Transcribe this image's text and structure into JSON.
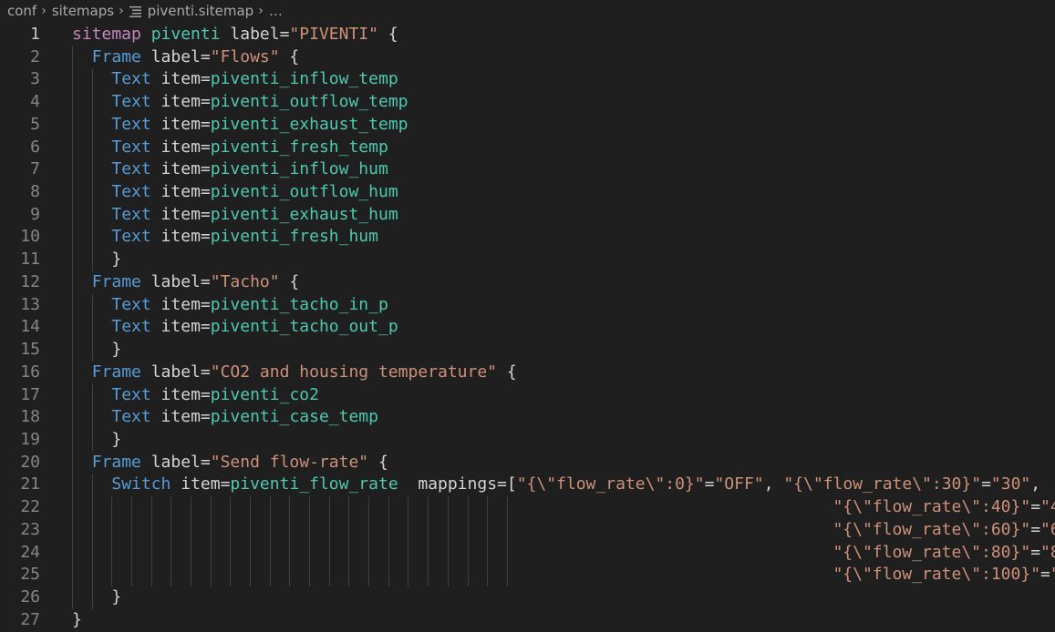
{
  "breadcrumb": {
    "items": [
      "conf",
      "sitemaps",
      "piventi.sitemap",
      "…"
    ],
    "separator": "›"
  },
  "icons": {
    "file_icon": "lines-file-icon",
    "chevron": "chevron-right-icon"
  },
  "colors": {
    "background": "#1f1f1f",
    "keyword_purple": "#c586c0",
    "keyword_blue": "#569cd6",
    "identifier_teal": "#4ec9b0",
    "string_orange": "#ce9178",
    "default_text": "#d4d4d4",
    "line_number": "#858585"
  },
  "editor": {
    "active_line": 1,
    "lines": [
      {
        "n": "1",
        "tokens": [
          {
            "t": "sitemap",
            "c": "kw"
          },
          {
            "t": " "
          },
          {
            "t": "piventi",
            "c": "id"
          },
          {
            "t": " label="
          },
          {
            "t": "\"PIVENTI\"",
            "c": "str"
          },
          {
            "t": " {"
          }
        ]
      },
      {
        "n": "2",
        "tokens": [
          {
            "t": "  "
          },
          {
            "t": "Frame",
            "c": "kw2"
          },
          {
            "t": " label="
          },
          {
            "t": "\"Flows\"",
            "c": "str"
          },
          {
            "t": " {"
          }
        ]
      },
      {
        "n": "3",
        "tokens": [
          {
            "t": "    "
          },
          {
            "t": "Text",
            "c": "kw2"
          },
          {
            "t": " item="
          },
          {
            "t": "piventi_inflow_temp",
            "c": "id"
          }
        ]
      },
      {
        "n": "4",
        "tokens": [
          {
            "t": "    "
          },
          {
            "t": "Text",
            "c": "kw2"
          },
          {
            "t": " item="
          },
          {
            "t": "piventi_outflow_temp",
            "c": "id"
          }
        ]
      },
      {
        "n": "5",
        "tokens": [
          {
            "t": "    "
          },
          {
            "t": "Text",
            "c": "kw2"
          },
          {
            "t": " item="
          },
          {
            "t": "piventi_exhaust_temp",
            "c": "id"
          }
        ]
      },
      {
        "n": "6",
        "tokens": [
          {
            "t": "    "
          },
          {
            "t": "Text",
            "c": "kw2"
          },
          {
            "t": " item="
          },
          {
            "t": "piventi_fresh_temp",
            "c": "id"
          }
        ]
      },
      {
        "n": "7",
        "tokens": [
          {
            "t": "    "
          },
          {
            "t": "Text",
            "c": "kw2"
          },
          {
            "t": " item="
          },
          {
            "t": "piventi_inflow_hum",
            "c": "id"
          }
        ]
      },
      {
        "n": "8",
        "tokens": [
          {
            "t": "    "
          },
          {
            "t": "Text",
            "c": "kw2"
          },
          {
            "t": " item="
          },
          {
            "t": "piventi_outflow_hum",
            "c": "id"
          }
        ]
      },
      {
        "n": "9",
        "tokens": [
          {
            "t": "    "
          },
          {
            "t": "Text",
            "c": "kw2"
          },
          {
            "t": " item="
          },
          {
            "t": "piventi_exhaust_hum",
            "c": "id"
          }
        ]
      },
      {
        "n": "10",
        "tokens": [
          {
            "t": "    "
          },
          {
            "t": "Text",
            "c": "kw2"
          },
          {
            "t": " item="
          },
          {
            "t": "piventi_fresh_hum",
            "c": "id"
          }
        ]
      },
      {
        "n": "11",
        "tokens": [
          {
            "t": "    }"
          }
        ]
      },
      {
        "n": "12",
        "tokens": [
          {
            "t": "  "
          },
          {
            "t": "Frame",
            "c": "kw2"
          },
          {
            "t": " label="
          },
          {
            "t": "\"Tacho\"",
            "c": "str"
          },
          {
            "t": " {"
          }
        ]
      },
      {
        "n": "13",
        "tokens": [
          {
            "t": "    "
          },
          {
            "t": "Text",
            "c": "kw2"
          },
          {
            "t": " item="
          },
          {
            "t": "piventi_tacho_in_p",
            "c": "id"
          }
        ]
      },
      {
        "n": "14",
        "tokens": [
          {
            "t": "    "
          },
          {
            "t": "Text",
            "c": "kw2"
          },
          {
            "t": " item="
          },
          {
            "t": "piventi_tacho_out_p",
            "c": "id"
          }
        ]
      },
      {
        "n": "15",
        "tokens": [
          {
            "t": "    }"
          }
        ]
      },
      {
        "n": "16",
        "tokens": [
          {
            "t": "  "
          },
          {
            "t": "Frame",
            "c": "kw2"
          },
          {
            "t": " label="
          },
          {
            "t": "\"CO2 and housing temperature\"",
            "c": "str"
          },
          {
            "t": " {"
          }
        ]
      },
      {
        "n": "17",
        "tokens": [
          {
            "t": "    "
          },
          {
            "t": "Text",
            "c": "kw2"
          },
          {
            "t": " item="
          },
          {
            "t": "piventi_co2",
            "c": "id"
          }
        ]
      },
      {
        "n": "18",
        "tokens": [
          {
            "t": "    "
          },
          {
            "t": "Text",
            "c": "kw2"
          },
          {
            "t": " item="
          },
          {
            "t": "piventi_case_temp",
            "c": "id"
          }
        ]
      },
      {
        "n": "19",
        "tokens": [
          {
            "t": "    }"
          }
        ]
      },
      {
        "n": "20",
        "tokens": [
          {
            "t": "  "
          },
          {
            "t": "Frame",
            "c": "kw2"
          },
          {
            "t": " label="
          },
          {
            "t": "\"Send flow-rate\"",
            "c": "str"
          },
          {
            "t": " {"
          }
        ]
      },
      {
        "n": "21",
        "tokens": [
          {
            "t": "    "
          },
          {
            "t": "Switch",
            "c": "kw2"
          },
          {
            "t": " item="
          },
          {
            "t": "piventi_flow_rate",
            "c": "id"
          },
          {
            "t": "  mappings=["
          },
          {
            "t": "\"{\\\"flow_rate\\\":0}\"",
            "c": "str"
          },
          {
            "t": "="
          },
          {
            "t": "\"OFF\"",
            "c": "str"
          },
          {
            "t": ", "
          },
          {
            "t": "\"{\\\"flow_rate\\\":30}\"",
            "c": "str"
          },
          {
            "t": "="
          },
          {
            "t": "\"30\"",
            "c": "str"
          },
          {
            "t": ","
          }
        ]
      },
      {
        "n": "22",
        "tokens": [
          {
            "t": "                                                                             "
          },
          {
            "t": "\"{\\\"flow_rate\\\":40}\"",
            "c": "str"
          },
          {
            "t": "="
          },
          {
            "t": "\"40\"",
            "c": "str"
          },
          {
            "t": ", "
          },
          {
            "t": "\"{\\\"flow_rate\\\":50}\"",
            "c": "str"
          },
          {
            "t": "="
          },
          {
            "t": "\"50\"",
            "c": "str"
          },
          {
            "t": ","
          }
        ]
      },
      {
        "n": "23",
        "tokens": [
          {
            "t": "                                                                             "
          },
          {
            "t": "\"{\\\"flow_rate\\\":60}\"",
            "c": "str"
          },
          {
            "t": "="
          },
          {
            "t": "\"60\"",
            "c": "str"
          },
          {
            "t": ", "
          },
          {
            "t": "\"{\\\"flow_rate\\\":70}\"",
            "c": "str"
          },
          {
            "t": "="
          },
          {
            "t": "\"70\"",
            "c": "str"
          },
          {
            "t": ","
          }
        ]
      },
      {
        "n": "24",
        "tokens": [
          {
            "t": "                                                                             "
          },
          {
            "t": "\"{\\\"flow_rate\\\":80}\"",
            "c": "str"
          },
          {
            "t": "="
          },
          {
            "t": "\"80\"",
            "c": "str"
          },
          {
            "t": ", "
          },
          {
            "t": "\"{\\\"flow_rate\\\":90}\"",
            "c": "str"
          },
          {
            "t": "="
          },
          {
            "t": "\"90\"",
            "c": "str"
          },
          {
            "t": ","
          }
        ]
      },
      {
        "n": "25",
        "tokens": [
          {
            "t": "                                                                             "
          },
          {
            "t": "\"{\\\"flow_rate\\\":100}\"",
            "c": "str"
          },
          {
            "t": "="
          },
          {
            "t": "\"100\"",
            "c": "str"
          },
          {
            "t": "]"
          }
        ]
      },
      {
        "n": "26",
        "tokens": [
          {
            "t": "    }"
          }
        ]
      },
      {
        "n": "27",
        "tokens": [
          {
            "t": "}"
          }
        ]
      }
    ]
  }
}
